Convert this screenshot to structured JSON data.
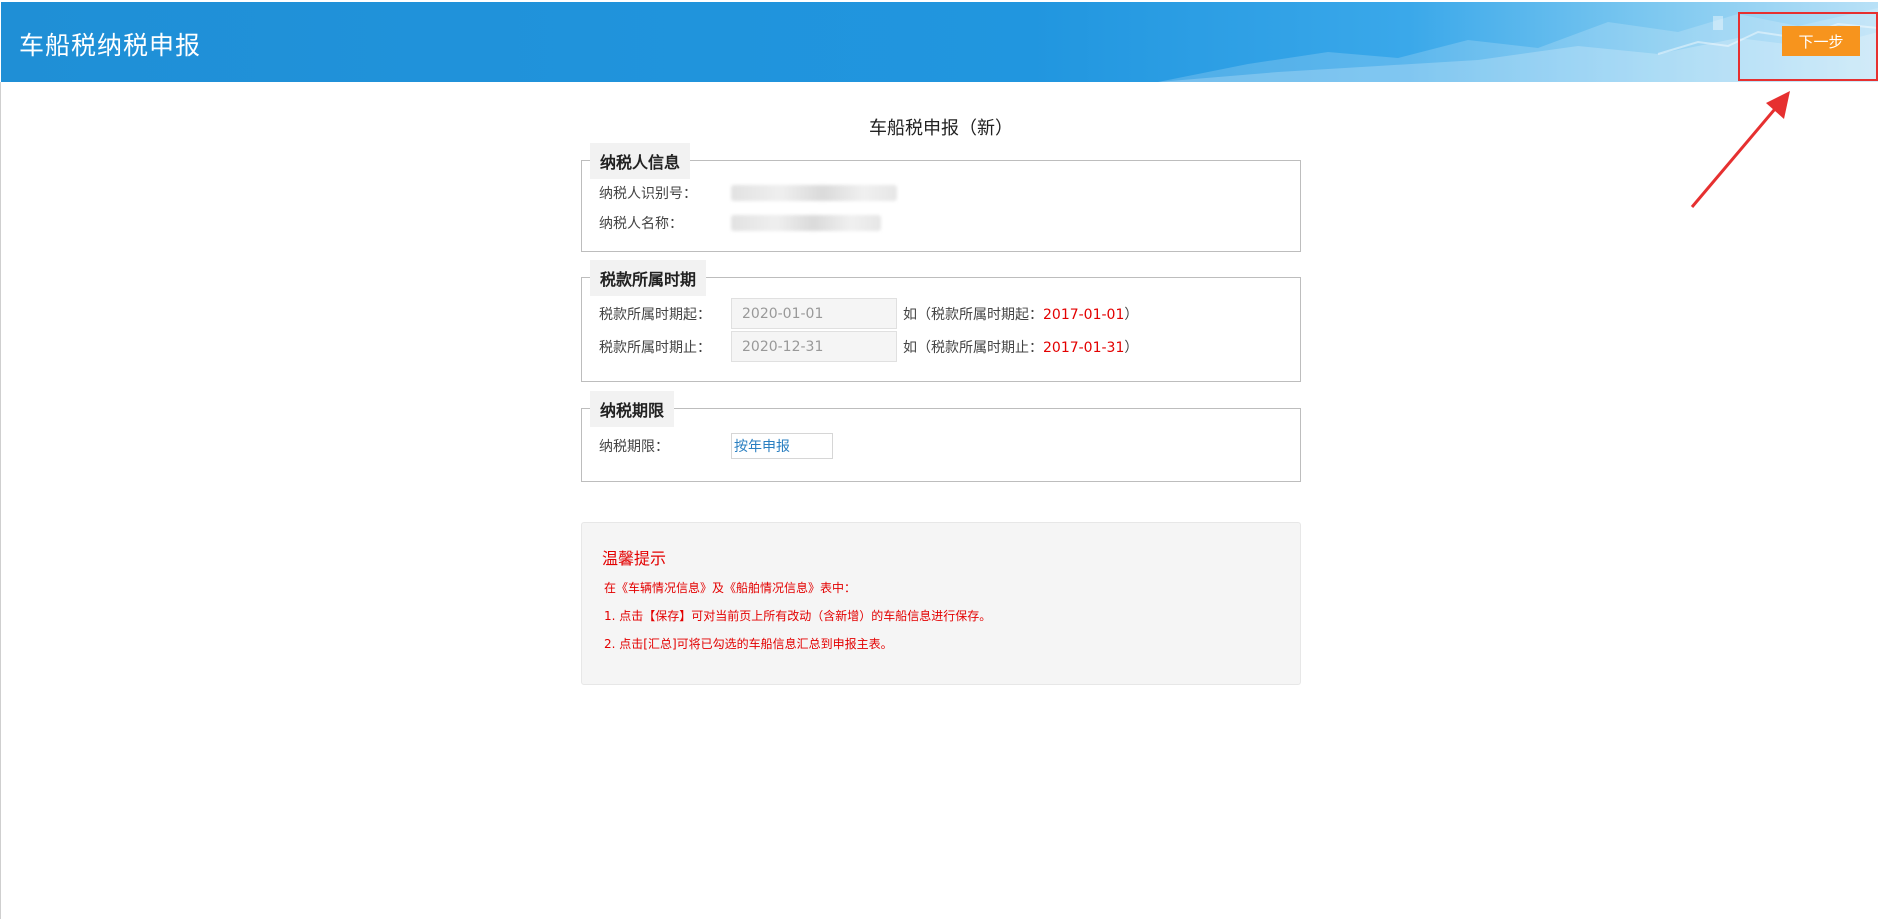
{
  "header": {
    "title": "车船税纳税申报",
    "next_button": "下一步"
  },
  "page": {
    "title": "车船税申报（新）"
  },
  "taxpayer_info": {
    "legend": "纳税人信息",
    "id_label": "纳税人识别号：",
    "name_label": "纳税人名称："
  },
  "tax_period": {
    "legend": "税款所属时期",
    "start_label": "税款所属时期起：",
    "start_value": "2020-01-01",
    "start_hint_prefix": "如（税款所属时期起：",
    "start_hint_example": "2017-01-01",
    "start_hint_suffix": "）",
    "end_label": "税款所属时期止：",
    "end_value": "2020-12-31",
    "end_hint_prefix": "如（税款所属时期止：",
    "end_hint_example": "2017-01-31",
    "end_hint_suffix": "）"
  },
  "tax_deadline": {
    "legend": "纳税期限",
    "label": "纳税期限：",
    "selected": "按年申报"
  },
  "tips": {
    "title": "温馨提示",
    "intro": "在《车辆情况信息》及《船舶情况信息》表中：",
    "line1": "1. 点击【保存】可对当前页上所有改动（含新增）的车船信息进行保存。",
    "line2": "2. 点击[汇总]可将已勾选的车船信息汇总到申报主表。"
  },
  "colors": {
    "header_blue": "#2196df",
    "next_button": "#f7941d",
    "warning_red": "#e30000",
    "annotation_red": "#e63030"
  }
}
